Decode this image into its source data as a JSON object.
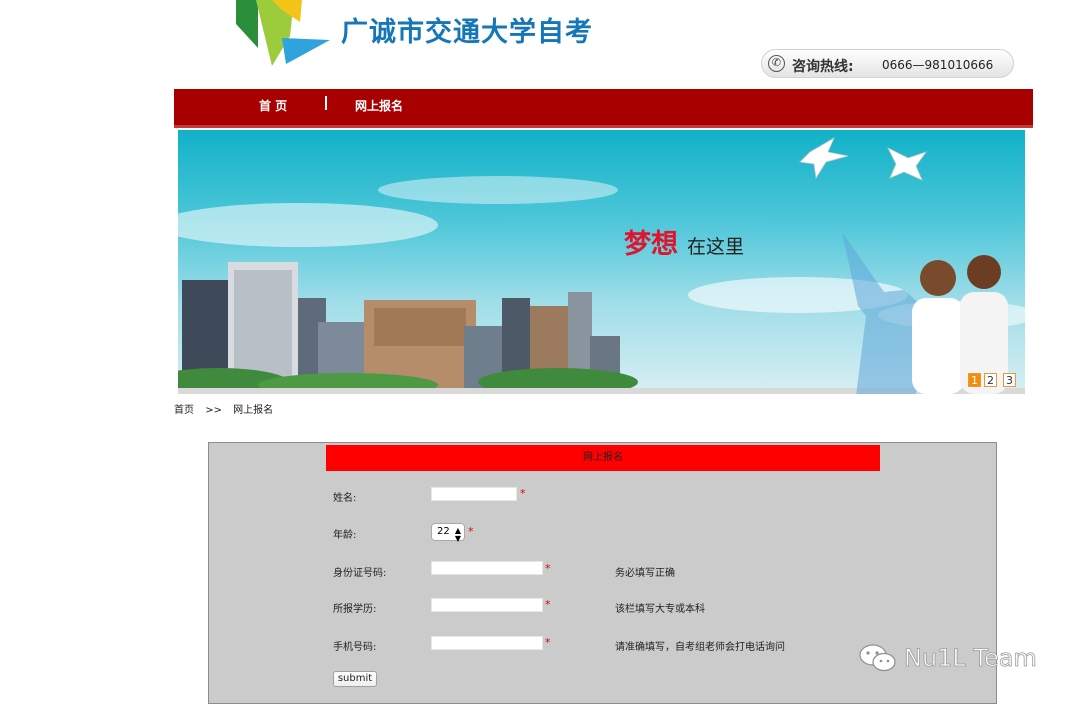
{
  "header": {
    "site_title": "广诚市交通大学自考",
    "hotline_label": "咨询热线:",
    "hotline_number": "0666—981010666"
  },
  "nav": {
    "items": [
      {
        "label": "首 页"
      },
      {
        "label": "网上报名"
      }
    ]
  },
  "banner": {
    "slogan_main": "梦想",
    "slogan_sub": "在这里",
    "pager": [
      "1",
      "2",
      "3"
    ],
    "active_page": "1"
  },
  "breadcrumb": {
    "home": "首页",
    "separator": ">>",
    "current": "网上报名"
  },
  "form": {
    "title": "网上报名",
    "required_mark": "*",
    "fields": {
      "name": {
        "label": "姓名:",
        "value": "",
        "hint": ""
      },
      "age": {
        "label": "年龄:",
        "value": "22",
        "hint": ""
      },
      "id_number": {
        "label": "身份证号码:",
        "value": "",
        "hint": "务必填写正确"
      },
      "education": {
        "label": "所报学历:",
        "value": "",
        "hint": "该栏填写大专或本科"
      },
      "phone": {
        "label": "手机号码:",
        "value": "",
        "hint": "请准确填写，自考组老师会打电话询问"
      }
    },
    "submit_label": "submit"
  },
  "watermark": {
    "text": "Nu1L Team"
  },
  "colors": {
    "nav_bg": "#a80000",
    "form_header_bg": "#ff0000",
    "panel_bg": "#cbcbcb",
    "required": "#e00000",
    "title_blue": "#1677b8"
  }
}
